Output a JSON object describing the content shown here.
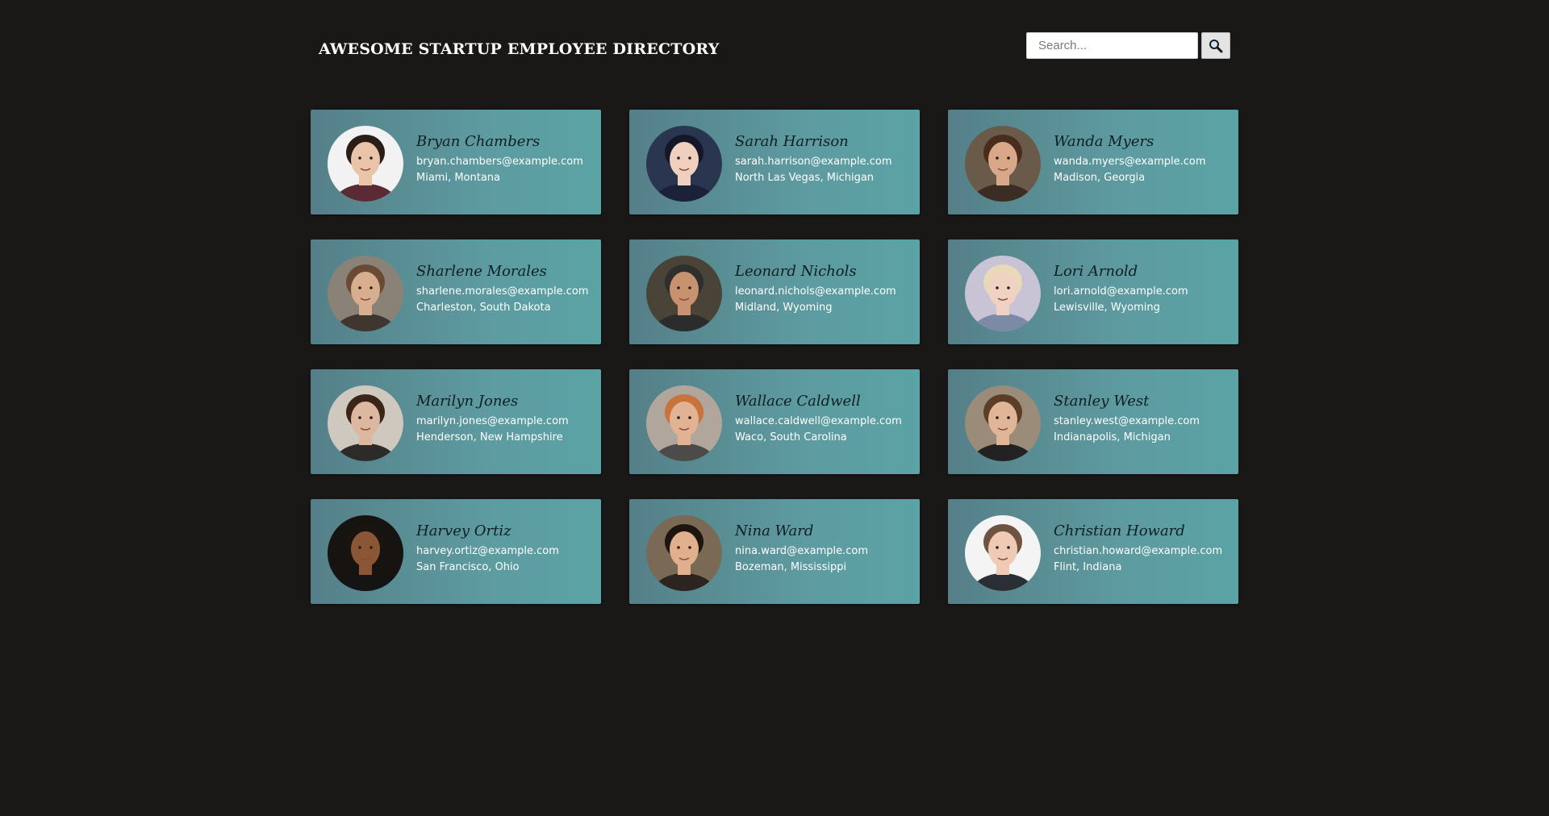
{
  "header": {
    "title": "AWESOME STARTUP EMPLOYEE DIRECTORY",
    "search_placeholder": "Search...",
    "search_value": ""
  },
  "employees": [
    {
      "name": "Bryan Chambers",
      "email": "bryan.chambers@example.com",
      "location": "Miami, Montana",
      "skin": "#e9c4a8",
      "hair": "#2a1d16",
      "bg": "#f2f2f2",
      "shirt": "#5a2b35"
    },
    {
      "name": "Sarah Harrison",
      "email": "sarah.harrison@example.com",
      "location": "North Las Vegas, Michigan",
      "skin": "#efcfbd",
      "hair": "#141826",
      "bg": "#2a3550",
      "shirt": "#1b2136"
    },
    {
      "name": "Wanda Myers",
      "email": "wanda.myers@example.com",
      "location": "Madison, Georgia",
      "skin": "#d9a88a",
      "hair": "#4a2c1c",
      "bg": "#6a5a4a",
      "shirt": "#3b2d24"
    },
    {
      "name": "Sharlene Morales",
      "email": "sharlene.morales@example.com",
      "location": "Charleston, South Dakota",
      "skin": "#d8ae90",
      "hair": "#6b4a33",
      "bg": "#8a8276",
      "shirt": "#403630"
    },
    {
      "name": "Leonard Nichols",
      "email": "leonard.nichols@example.com",
      "location": "Midland, Wyoming",
      "skin": "#c8916f",
      "hair": "#2f2f2f",
      "bg": "#4a4438",
      "shirt": "#2c2c2c"
    },
    {
      "name": "Lori Arnold",
      "email": "lori.arnold@example.com",
      "location": "Lewisville, Wyoming",
      "skin": "#f0d2c2",
      "hair": "#e9d9b8",
      "bg": "#c9c3d6",
      "shirt": "#7c8aa6"
    },
    {
      "name": "Marilyn Jones",
      "email": "marilyn.jones@example.com",
      "location": "Henderson, New Hampshire",
      "skin": "#dcb8a0",
      "hair": "#3a2619",
      "bg": "#cfc8bf",
      "shirt": "#2d2a2a"
    },
    {
      "name": "Wallace Caldwell",
      "email": "wallace.caldwell@example.com",
      "location": "Waco, South Carolina",
      "skin": "#e2b295",
      "hair": "#c8733b",
      "bg": "#b0a69c",
      "shirt": "#4d4a4a"
    },
    {
      "name": "Stanley West",
      "email": "stanley.west@example.com",
      "location": "Indianapolis, Michigan",
      "skin": "#e1b598",
      "hair": "#5a3e28",
      "bg": "#9a8c78",
      "shirt": "#222222"
    },
    {
      "name": "Harvey Ortiz",
      "email": "harvey.ortiz@example.com",
      "location": "San Francisco, Ohio",
      "skin": "#8a5636",
      "hair": "#1a1410",
      "bg": "#161311",
      "shirt": "#141414"
    },
    {
      "name": "Nina Ward",
      "email": "nina.ward@example.com",
      "location": "Bozeman, Mississippi",
      "skin": "#e0b08e",
      "hair": "#1f150f",
      "bg": "#7a6a55",
      "shirt": "#2b2420"
    },
    {
      "name": "Christian Howard",
      "email": "christian.howard@example.com",
      "location": "Flint, Indiana",
      "skin": "#efcbb5",
      "hair": "#6e5440",
      "bg": "#f4f4f4",
      "shirt": "#2a2f36"
    }
  ]
}
